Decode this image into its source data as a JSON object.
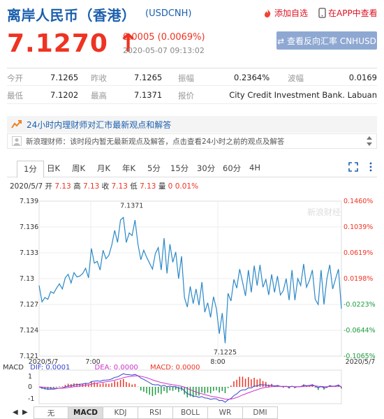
{
  "header": {
    "title": "离岸人民币（香港）",
    "code": "(USDCNH)",
    "favorite_label": "添加自选",
    "app_label": "在APP中查看"
  },
  "quote": {
    "price": "7.1270",
    "arrow": "↑",
    "change": "0.0005 (0.0069%)",
    "time": "2020-05-07 09:13:02",
    "reverse_button": "⇄ 查看反向汇率 CNHUSD"
  },
  "stats": [
    {
      "l1": "今开",
      "v1": "7.1265",
      "l2": "昨收",
      "v2": "7.1265",
      "l3": "振幅",
      "v3": "0.2364%",
      "l4": "波幅",
      "v4": "0.0169"
    },
    {
      "l1": "最低",
      "v1": "7.1202",
      "l2": "最高",
      "v2": "7.1371",
      "l3": "报价",
      "v3": "City Credit Investment Bank. Labuan"
    }
  ],
  "news": {
    "header": "24小时内理财师对汇市最新观点和解答",
    "body": "新浪理财师：该时段内暂无最新观点及解答，点击查看24小时之前的观点及解答"
  },
  "tabs": [
    "1分",
    "日K",
    "周K",
    "月K",
    "年K",
    "5分",
    "15分",
    "30分",
    "60分",
    "4H"
  ],
  "ohlc": {
    "date": "2020/5/7",
    "open_label": "开",
    "open": "7.13",
    "high_label": "高",
    "high": "7.13",
    "close_label": "收",
    "close": "7.13",
    "low_label": "低",
    "low": "7.13",
    "vol_label": "量",
    "vol": "0",
    "pct": "0.01%"
  },
  "chart_data": {
    "type": "line",
    "watermark": "新浪财经",
    "y_left_ticks": [
      "7.139",
      "7.136",
      "7.133",
      "7.13",
      "7.127",
      "7.124",
      "7.121"
    ],
    "y_right_ticks": [
      "0.1460%",
      "0.1039%",
      "0.0619%",
      "0.0198%",
      "-0.0223%",
      "-0.0644%",
      "-0.1065%"
    ],
    "x_ticks": [
      "2020/5/7",
      "7:00",
      "8:00",
      "2020/5/7"
    ],
    "ylim": [
      7.121,
      7.139
    ],
    "max_label": "7.1371",
    "min_label": "7.1225",
    "prev_close": 7.1265,
    "colors": {
      "line": "#2a88c8",
      "up": "#e32",
      "down": "#1a9a3b",
      "dif": "#3344cc",
      "dea": "#cc33cc"
    },
    "series": [
      {
        "values": [
          7.1292,
          7.1273,
          7.1278,
          7.1276,
          7.1285,
          7.1283,
          7.1289,
          7.1294,
          7.1288,
          7.1301,
          7.1305,
          7.1295,
          7.1307,
          7.1302,
          7.1303,
          7.1306,
          7.1312,
          7.1301,
          7.1335,
          7.1318,
          7.132,
          7.131,
          7.1333,
          7.1323,
          7.1327,
          7.1339,
          7.1356,
          7.1342,
          7.1368,
          7.1371,
          7.1342,
          7.1353,
          7.135,
          7.1368,
          7.134,
          7.1322,
          7.1333,
          7.1325,
          7.1318,
          7.1311,
          7.1329,
          7.1336,
          7.131,
          7.1347,
          7.1306,
          7.134,
          7.1319,
          7.1331,
          7.13,
          7.1326,
          7.1278,
          7.1267,
          7.1291,
          7.1271,
          7.1288,
          7.1269,
          7.1296,
          7.1261,
          7.1272,
          7.1255,
          7.1279,
          7.1265,
          7.1236,
          7.126,
          7.1225,
          7.1283,
          7.1274,
          7.1299,
          7.1289,
          7.1311,
          7.1296,
          7.128,
          7.131,
          7.1284,
          7.1315,
          7.1292,
          7.1316,
          7.129,
          7.1299,
          7.1281,
          7.1305,
          7.1284,
          7.1303,
          7.1281,
          7.1286,
          7.13,
          7.1275,
          7.131,
          7.1275,
          7.13,
          7.1292,
          7.1317,
          7.129,
          7.1298,
          7.131,
          7.1276,
          7.127,
          7.131,
          7.127,
          7.13,
          7.1316,
          7.1288,
          7.13,
          7.1311,
          7.1265
        ]
      }
    ],
    "macd": {
      "dif_label": "DIF:",
      "dif": "0.0001",
      "dea_label": "DEA:",
      "dea": "0.0000",
      "macd_label": "MACD:",
      "macd": "0.0000",
      "y_ticks": [
        "1",
        "0",
        "-1"
      ]
    }
  },
  "bottom_tabs": [
    "无",
    "MACD",
    "KDJ",
    "RSI",
    "BOLL",
    "WR",
    "DMI"
  ],
  "nav": {
    "prev": "◀",
    "next": "▶"
  }
}
